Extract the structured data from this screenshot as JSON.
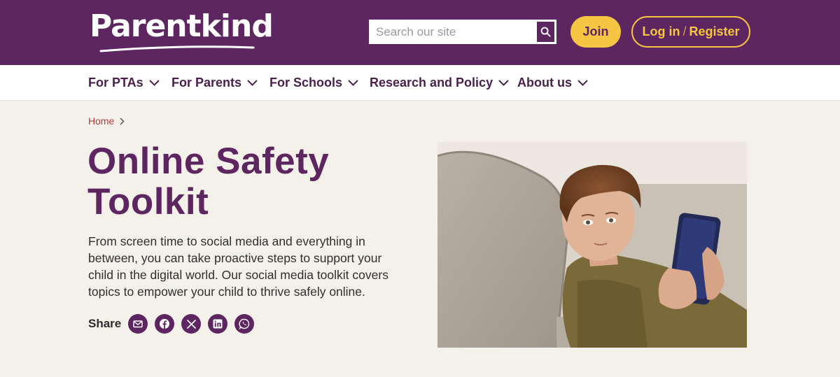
{
  "brand": {
    "logo_text": "Parentkind",
    "colors": {
      "primary": "#5e2660",
      "accent": "#f6c544",
      "background": "#f4f1ea",
      "breadcrumb": "#b23a3a"
    }
  },
  "header": {
    "search": {
      "placeholder": "Search our site",
      "value": "",
      "icon": "search-icon"
    },
    "join_label": "Join",
    "login_label": "Log in",
    "login_separator": "/",
    "register_label": "Register"
  },
  "nav": {
    "items": [
      {
        "label": "For PTAs"
      },
      {
        "label": "For Parents"
      },
      {
        "label": "For Schools"
      },
      {
        "label": "Research and Policy"
      },
      {
        "label": "About us"
      }
    ]
  },
  "breadcrumb": {
    "home": "Home"
  },
  "main": {
    "title": "Online Safety Toolkit",
    "intro": "From screen time to social media and everything in between, you can take proactive steps to support your child in the digital world. Our social media toolkit covers topics to empower your child to thrive safely online.",
    "share_label": "Share",
    "share_icons": [
      "email-icon",
      "facebook-icon",
      "x-icon",
      "linkedin-icon",
      "whatsapp-icon"
    ],
    "hero_image": "boy-on-sofa-with-smartphone"
  }
}
